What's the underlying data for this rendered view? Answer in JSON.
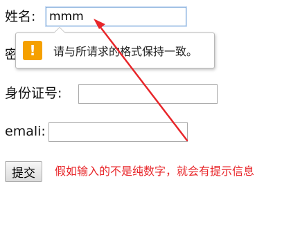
{
  "form": {
    "name_label": "姓名:",
    "name_value": "mmm",
    "password_label_partial": "密",
    "id_label": "身份证号:",
    "id_value": "",
    "email_label": "emali:",
    "email_value": "",
    "submit_label": "提交"
  },
  "tooltip": {
    "icon_glyph": "!",
    "message": "请与所请求的格式保持一致。"
  },
  "annotation": {
    "text": "假如输入的不是纯数字，就会有提示信息"
  },
  "colors": {
    "annotation_red": "#e8262a",
    "warning_orange": "#f5a000",
    "focus_blue": "#7aa7d8"
  }
}
